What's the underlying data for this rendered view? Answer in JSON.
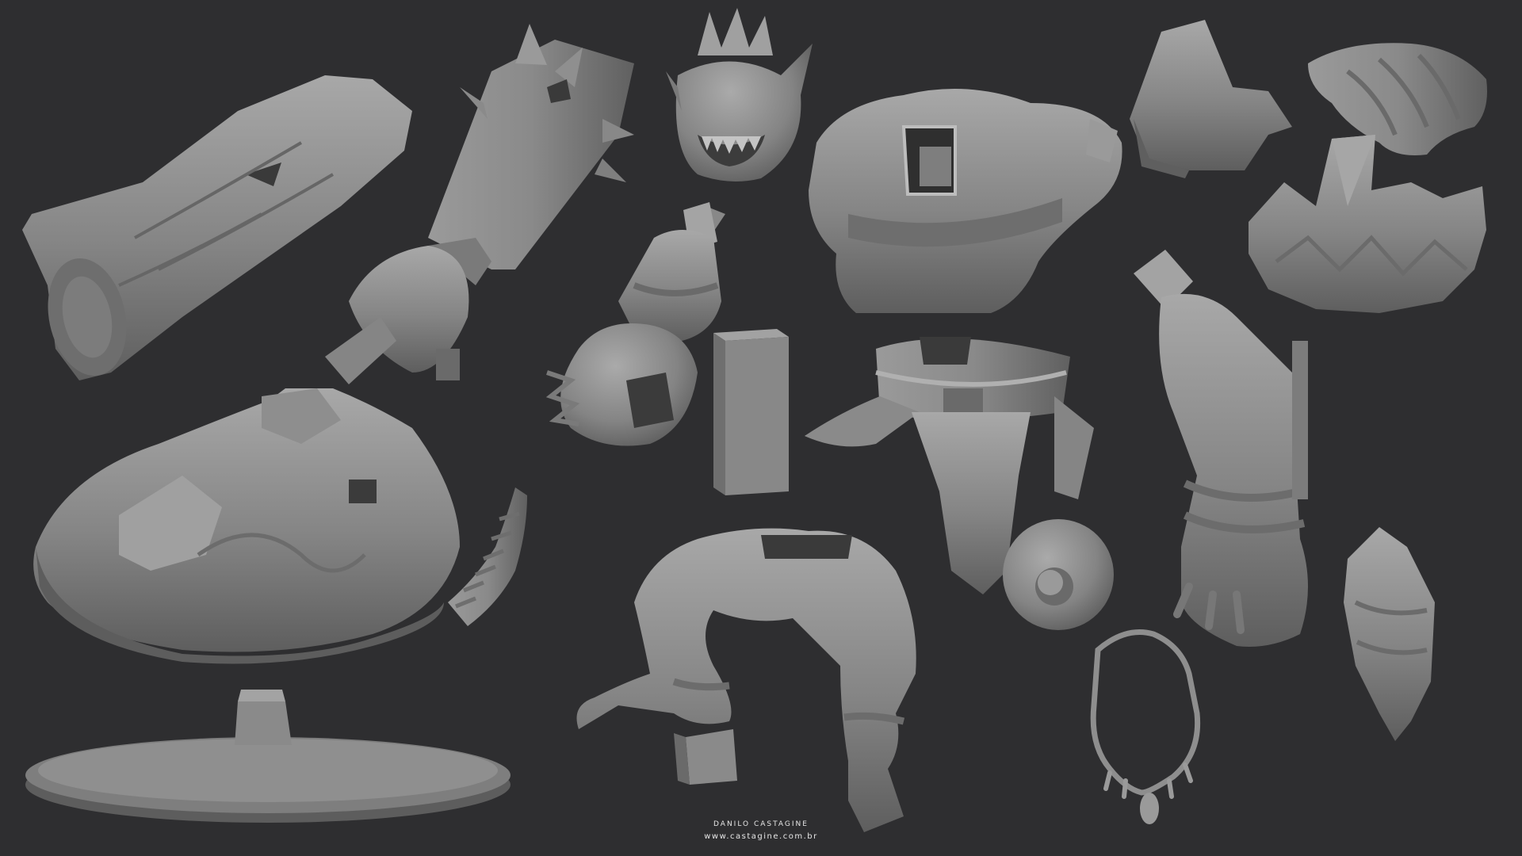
{
  "credit": {
    "author": "DANILO CASTAGINE",
    "website": "www.castagine.com.br"
  },
  "colors": {
    "background": "#2e2e30",
    "clay": "#8a8a8a",
    "clay_light": "#a9a9a9",
    "clay_dark": "#5f5f5f"
  },
  "parts": [
    "log",
    "spiked-club-arm",
    "troll-head",
    "torso",
    "shoulder-pad-right",
    "hair-tuft",
    "left-forearm",
    "peg-block",
    "belt-loincloth",
    "right-arm-hand",
    "leaf-crest",
    "rock-base",
    "hair-strip",
    "legs",
    "round-shield",
    "necklace",
    "bracer-plate",
    "display-pedestal"
  ]
}
